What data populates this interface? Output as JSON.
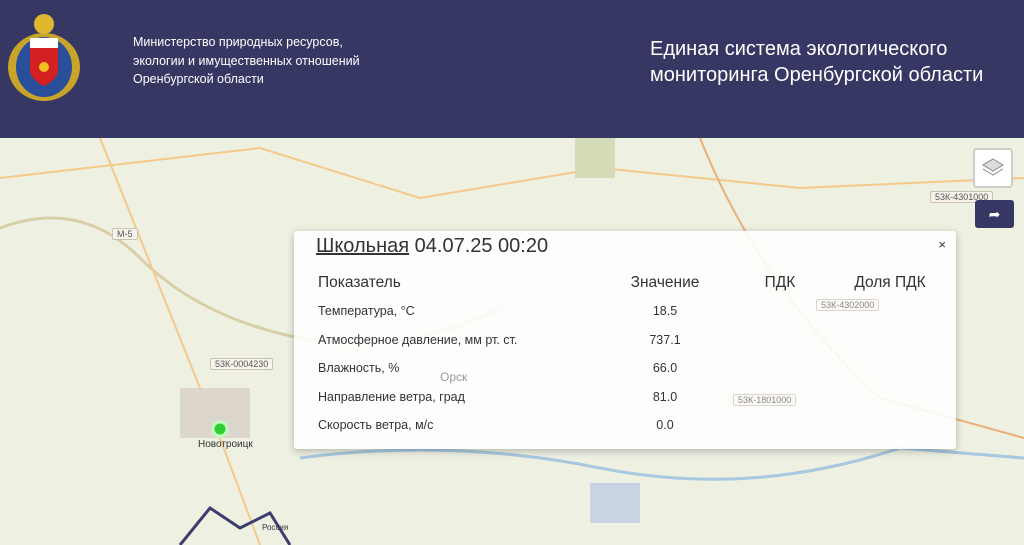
{
  "header": {
    "ministry_lines": [
      "Министерство природных ресурсов,",
      "экологии и имущественных отношений",
      "Оренбургской области"
    ],
    "system_lines": [
      "Единая система экологического",
      "мониторинга Оренбургской области"
    ]
  },
  "map": {
    "labels": [
      "М-5",
      "53К-0004230",
      "53К-4301000",
      "53К-4302000",
      "53К-1801000"
    ],
    "cities": [
      "Новотроицк",
      "Орск",
      "Россия"
    ]
  },
  "colors": {
    "header": "#373763",
    "station": "#33cc33"
  },
  "popup": {
    "station": "Школьная",
    "datetime": "04.07.25 00:20",
    "close": "×",
    "columns": [
      "Показатель",
      "Значение",
      "ПДК",
      "Доля ПДК"
    ],
    "rows": [
      {
        "name": "Температура, °C",
        "value": "18.5"
      },
      {
        "name": "Атмосферное давление, мм рт. ст.",
        "value": "737.1"
      },
      {
        "name": "Влажность, %",
        "value": "66.0"
      },
      {
        "name": "Направление ветра, град",
        "value": "81.0"
      },
      {
        "name": "Скорость ветра, м/с",
        "value": "0.0"
      }
    ]
  }
}
